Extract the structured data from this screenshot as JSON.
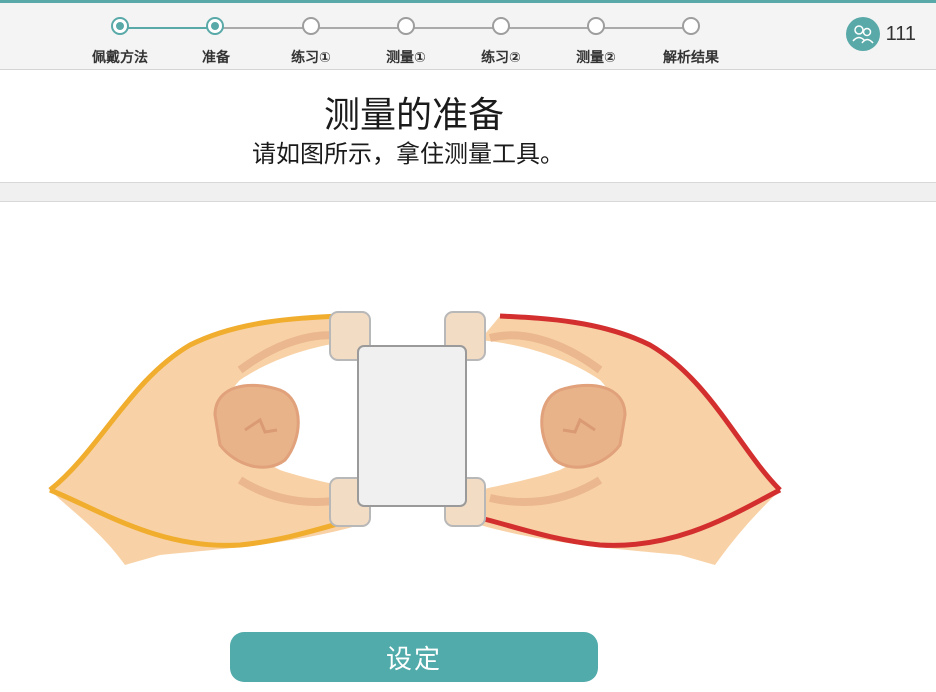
{
  "steps": [
    {
      "label": "佩戴方法",
      "state": "done"
    },
    {
      "label": "准备",
      "state": "current"
    },
    {
      "label": "练习①",
      "state": "todo"
    },
    {
      "label": "测量①",
      "state": "todo"
    },
    {
      "label": "练习②",
      "state": "todo"
    },
    {
      "label": "测量②",
      "state": "todo"
    },
    {
      "label": "解析结果",
      "state": "todo"
    }
  ],
  "user": {
    "id": "111",
    "icon": "user-avatar-icon"
  },
  "header": {
    "title": "测量的准备",
    "subtitle": "请如图所示，拿住测量工具。"
  },
  "actions": {
    "set_label": "设定"
  },
  "colors": {
    "accent": "#52abab",
    "left_hand_outline": "#f0ad2e",
    "right_hand_outline": "#d32f2f",
    "skin": "#f8d2a6"
  }
}
